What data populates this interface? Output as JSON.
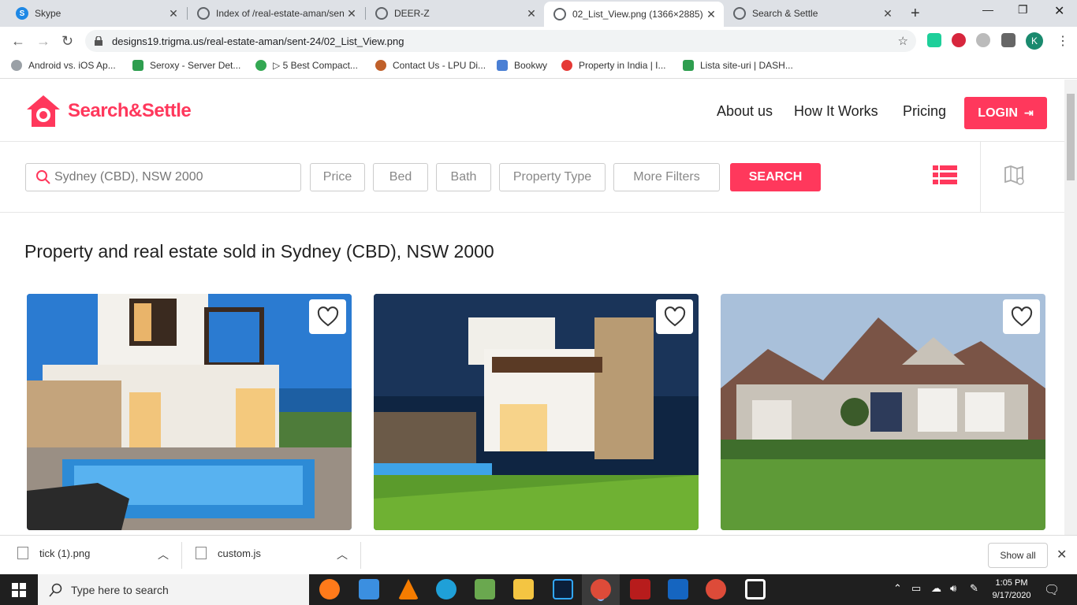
{
  "browser": {
    "tabs": [
      {
        "label": "Skype",
        "icon": "skype-icon",
        "color": "#1e88e5"
      },
      {
        "label": "Index of /real-estate-aman/sen",
        "icon": "globe-icon",
        "color": "#5f6368"
      },
      {
        "label": "DEER-Z",
        "icon": "globe-icon",
        "color": "#5f6368"
      },
      {
        "label": "02_List_View.png (1366×2885)",
        "icon": "globe-icon",
        "color": "#5f6368"
      },
      {
        "label": "Search & Settle",
        "icon": "globe-icon",
        "color": "#5f6368"
      }
    ],
    "active_tab_index": 3,
    "url": "designs19.trigma.us/real-estate-aman/sent-24/02_List_View.png",
    "profile_initial": "K",
    "bookmarks": [
      {
        "label": "Android vs. iOS Ap...",
        "color": "#9aa0a6"
      },
      {
        "label": "Seroxy - Server Det...",
        "color": "#2e9e4f"
      },
      {
        "label": "▷ 5 Best Compact...",
        "color": "#34a853"
      },
      {
        "label": "Contact Us - LPU Di...",
        "color": "#c0602a"
      },
      {
        "label": "Bookwy",
        "color": "#4a7fd4"
      },
      {
        "label": "Property in India | I...",
        "color": "#e53935"
      },
      {
        "label": "Lista site-uri | DASH...",
        "color": "#2e9e4f"
      }
    ]
  },
  "site": {
    "brand": "Search&Settle",
    "brand_color": "#ff385c",
    "nav": [
      "About us",
      "How It Works",
      "Pricing"
    ],
    "login_label": "LOGIN",
    "search_value": "Sydney (CBD), NSW 2000",
    "filters": [
      "Price",
      "Bed",
      "Bath",
      "Property Type",
      "More Filters"
    ],
    "search_button": "SEARCH",
    "heading": "Property and real estate sold in Sydney (CBD), NSW 2000",
    "listings": [
      {
        "image": "modern-house-pool-dusk",
        "favorite": false
      },
      {
        "image": "modern-house-night-lawn",
        "favorite": false
      },
      {
        "image": "suburban-house-lawn",
        "favorite": false
      }
    ]
  },
  "downloads": {
    "items": [
      "tick (1).png",
      "custom.js"
    ],
    "show_all": "Show all"
  },
  "taskbar": {
    "search_placeholder": "Type here to search",
    "time": "1:05 PM",
    "date": "9/17/2020"
  }
}
